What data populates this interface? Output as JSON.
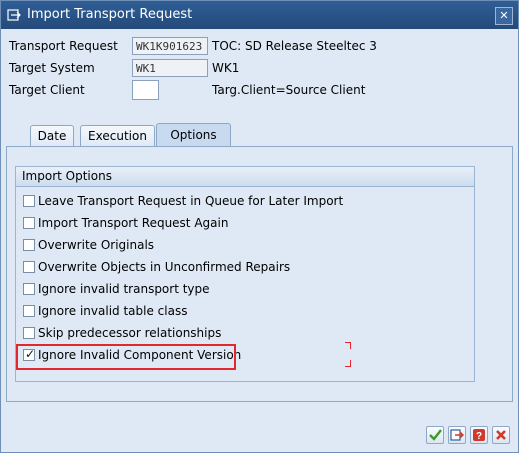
{
  "window": {
    "title": "Import Transport Request"
  },
  "header": {
    "transport_request": {
      "label": "Transport Request",
      "value": "WK1K901623",
      "description": "TOC: SD Release Steeltec 3"
    },
    "target_system": {
      "label": "Target System",
      "value": "WK1",
      "description": "WK1"
    },
    "target_client": {
      "label": "Target Client",
      "value": "",
      "description": "Targ.Client=Source Client"
    }
  },
  "tabs": [
    {
      "label": "Date",
      "active": false
    },
    {
      "label": "Execution",
      "active": false
    },
    {
      "label": "Options",
      "active": true
    }
  ],
  "import_options": {
    "title": "Import Options",
    "items": [
      {
        "label": "Leave Transport Request in Queue for Later Import",
        "checked": false
      },
      {
        "label": "Import Transport Request Again",
        "checked": false
      },
      {
        "label": "Overwrite Originals",
        "checked": false
      },
      {
        "label": "Overwrite Objects in Unconfirmed Repairs",
        "checked": false
      },
      {
        "label": "Ignore invalid transport type",
        "checked": false
      },
      {
        "label": "Ignore invalid table class",
        "checked": false
      },
      {
        "label": "Skip predecessor relationships",
        "checked": false
      },
      {
        "label": "Ignore Invalid Component Version",
        "checked": true
      }
    ]
  },
  "footer": {
    "buttons": [
      {
        "icon": "checkmark-icon",
        "color": "#3a9a2a"
      },
      {
        "icon": "transport-icon",
        "color": "#2a5fa0"
      },
      {
        "icon": "help-icon",
        "color": "#d13a2a"
      },
      {
        "icon": "cancel-icon",
        "color": "#d13a2a"
      }
    ]
  },
  "colors": {
    "titlebar": "#2f5e96",
    "highlight": "#e0282d",
    "background": "#dfe9f5"
  }
}
